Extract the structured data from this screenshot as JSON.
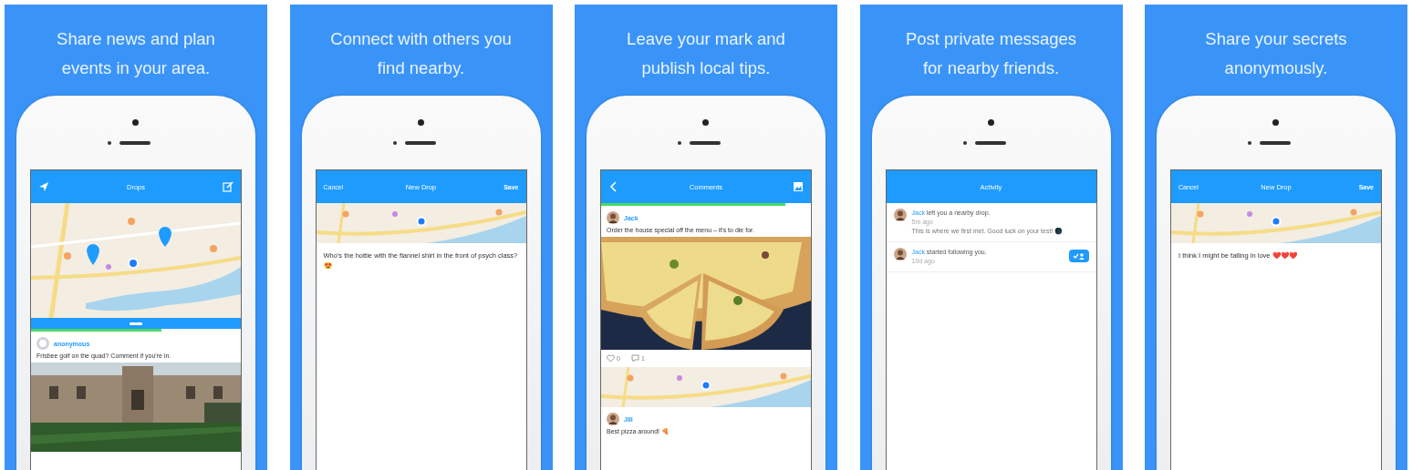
{
  "panels": [
    {
      "headline": "Share news and plan events in your area.",
      "screen": {
        "nav": {
          "title": "Drops",
          "left": {
            "kind": "send"
          },
          "right": {
            "kind": "edit"
          }
        },
        "blocks": [
          {
            "kind": "map"
          },
          {
            "kind": "handle"
          },
          {
            "kind": "progress",
            "level": 0.62
          },
          {
            "kind": "anonymous-post",
            "author": "anonymous",
            "text": "Frisbee golf on the quad? Comment if you're in."
          },
          {
            "kind": "picture"
          }
        ]
      }
    },
    {
      "headline": "Connect with others you find nearby.",
      "screen": {
        "nav": {
          "title": "New Drop",
          "left": {
            "kind": "text",
            "label": "Cancel"
          },
          "right": {
            "kind": "text",
            "label": "Save"
          }
        },
        "blocks": [
          {
            "kind": "map-strip"
          },
          {
            "kind": "compose",
            "text": "Who's the hottie with the flannel shirt in the front of psych class? 😍"
          }
        ]
      }
    },
    {
      "headline": "Leave your mark and publish local tips.",
      "screen": {
        "nav": {
          "title": "Comments",
          "left": {
            "kind": "back"
          },
          "right": {
            "kind": "gallery"
          }
        },
        "blocks": [
          {
            "kind": "progress",
            "level": 0.88
          },
          {
            "kind": "post",
            "author": "Jack",
            "text": "Order the house special off the menu – it's to die for."
          },
          {
            "kind": "picture"
          },
          {
            "kind": "reactions",
            "likes": "0",
            "comments": "1"
          },
          {
            "kind": "map-strip"
          },
          {
            "kind": "post",
            "author": "Jill",
            "text": "Best pizza around! 🍕"
          }
        ]
      }
    },
    {
      "headline": "Post private messages for nearby friends.",
      "screen": {
        "nav": {
          "title": "Activity"
        },
        "blocks": [
          {
            "kind": "activity",
            "author": "Jack",
            "text": "left you a nearby drop.",
            "time": "5m ago",
            "note": "This is where we first met. Good luck on your test! 🌑"
          },
          {
            "kind": "activity",
            "author": "Jack",
            "text": "started following you.",
            "time": "10d ago",
            "follow": true
          }
        ]
      }
    },
    {
      "headline": "Share your secrets anonymously.",
      "screen": {
        "nav": {
          "title": "New Drop",
          "left": {
            "kind": "text",
            "label": "Cancel"
          },
          "right": {
            "kind": "text",
            "label": "Save"
          }
        },
        "blocks": [
          {
            "kind": "map-strip"
          },
          {
            "kind": "compose",
            "text": "I think I might be falling in love ❤️❤️❤️"
          }
        ]
      }
    }
  ]
}
